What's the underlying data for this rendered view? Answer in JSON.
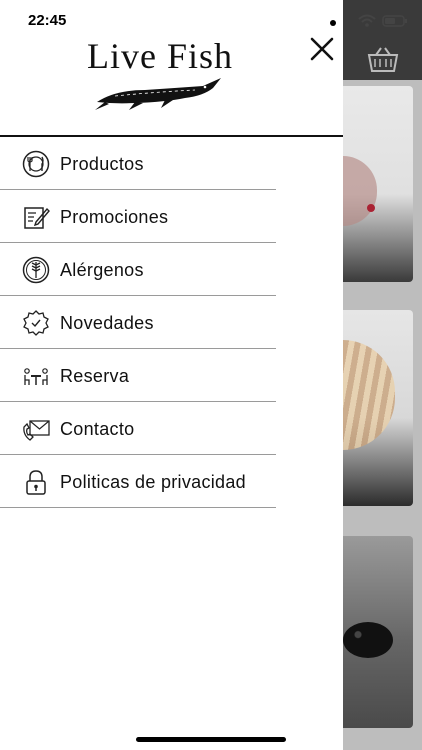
{
  "status_bar": {
    "time": "22:45"
  },
  "app": {
    "logo_text": "Live Fish"
  },
  "menu": {
    "items": [
      {
        "label": "Productos",
        "icon": "dish-icon"
      },
      {
        "label": "Promociones",
        "icon": "document-edit-icon"
      },
      {
        "label": "Alérgenos",
        "icon": "wheat-icon"
      },
      {
        "label": "Novedades",
        "icon": "badge-icon"
      },
      {
        "label": "Reserva",
        "icon": "table-reservation-icon"
      },
      {
        "label": "Contacto",
        "icon": "envelope-phone-icon"
      },
      {
        "label": "Politicas de privacidad",
        "icon": "lock-icon"
      }
    ]
  },
  "colors": {
    "text": "#111111",
    "divider": "#9a9a9a",
    "background": "#ffffff"
  }
}
